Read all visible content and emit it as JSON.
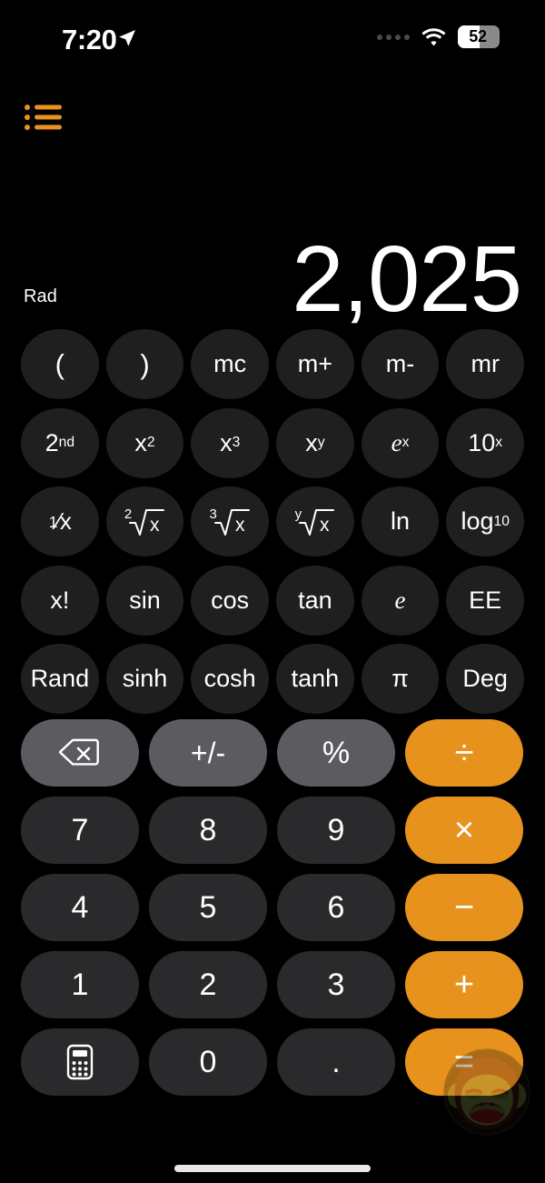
{
  "status_bar": {
    "time": "7:20",
    "location_icon": "location-arrow-icon",
    "signal_icon": "cellular-dots-icon",
    "wifi_icon": "wifi-icon",
    "battery_level": "52",
    "battery_percent": 52
  },
  "header": {
    "menu_icon": "list-bullet-icon",
    "menu_label": "History"
  },
  "display": {
    "mode": "Rad",
    "value": "2,025"
  },
  "scientific_keys": [
    [
      {
        "label": "(",
        "name": "open-paren-key"
      },
      {
        "label": ")",
        "name": "close-paren-key"
      },
      {
        "label": "mc",
        "name": "memory-clear-key"
      },
      {
        "label": "m+",
        "name": "memory-add-key"
      },
      {
        "label": "m-",
        "name": "memory-subtract-key"
      },
      {
        "label": "mr",
        "name": "memory-recall-key"
      }
    ],
    [
      {
        "label": "2nd",
        "name": "second-function-key"
      },
      {
        "label": "x2",
        "name": "x-squared-key"
      },
      {
        "label": "x3",
        "name": "x-cubed-key"
      },
      {
        "label": "xy",
        "name": "x-to-the-y-key"
      },
      {
        "label": "ex",
        "name": "e-to-the-x-key"
      },
      {
        "label": "10x",
        "name": "ten-to-the-x-key"
      }
    ],
    [
      {
        "label": "1/x",
        "name": "reciprocal-key"
      },
      {
        "label": "2root",
        "name": "square-root-key"
      },
      {
        "label": "3root",
        "name": "cube-root-key"
      },
      {
        "label": "yroot",
        "name": "y-root-key"
      },
      {
        "label": "ln",
        "name": "natural-log-key"
      },
      {
        "label": "log10",
        "name": "log-base-ten-key"
      }
    ],
    [
      {
        "label": "x!",
        "name": "factorial-key"
      },
      {
        "label": "sin",
        "name": "sine-key"
      },
      {
        "label": "cos",
        "name": "cosine-key"
      },
      {
        "label": "tan",
        "name": "tangent-key"
      },
      {
        "label": "e",
        "name": "euler-constant-key"
      },
      {
        "label": "EE",
        "name": "exponent-entry-key"
      }
    ],
    [
      {
        "label": "Rand",
        "name": "random-key"
      },
      {
        "label": "sinh",
        "name": "hyperbolic-sine-key"
      },
      {
        "label": "cosh",
        "name": "hyperbolic-cosine-key"
      },
      {
        "label": "tanh",
        "name": "hyperbolic-tangent-key"
      },
      {
        "label": "π",
        "name": "pi-key"
      },
      {
        "label": "Deg",
        "name": "degrees-toggle-key"
      }
    ]
  ],
  "keypad_rows": [
    [
      {
        "label": "",
        "name": "delete-key",
        "style": "func",
        "icon": "backspace-icon"
      },
      {
        "label": "+/-",
        "name": "plus-minus-key",
        "style": "func"
      },
      {
        "label": "%",
        "name": "percent-key",
        "style": "func"
      },
      {
        "label": "÷",
        "name": "divide-key",
        "style": "op"
      }
    ],
    [
      {
        "label": "7",
        "name": "digit-7-key",
        "style": "num"
      },
      {
        "label": "8",
        "name": "digit-8-key",
        "style": "num"
      },
      {
        "label": "9",
        "name": "digit-9-key",
        "style": "num"
      },
      {
        "label": "×",
        "name": "multiply-key",
        "style": "op"
      }
    ],
    [
      {
        "label": "4",
        "name": "digit-4-key",
        "style": "num"
      },
      {
        "label": "5",
        "name": "digit-5-key",
        "style": "num"
      },
      {
        "label": "6",
        "name": "digit-6-key",
        "style": "num"
      },
      {
        "label": "−",
        "name": "subtract-key",
        "style": "op"
      }
    ],
    [
      {
        "label": "1",
        "name": "digit-1-key",
        "style": "num"
      },
      {
        "label": "2",
        "name": "digit-2-key",
        "style": "num"
      },
      {
        "label": "3",
        "name": "digit-3-key",
        "style": "num"
      },
      {
        "label": "+",
        "name": "add-key",
        "style": "op"
      }
    ],
    [
      {
        "label": "",
        "name": "calculator-mode-key",
        "style": "num",
        "icon": "calculator-icon"
      },
      {
        "label": "0",
        "name": "digit-0-key",
        "style": "num"
      },
      {
        "label": ".",
        "name": "decimal-point-key",
        "style": "num"
      },
      {
        "label": "=",
        "name": "equals-key",
        "style": "op"
      }
    ]
  ],
  "watermark": {
    "icon": "monkey-face-icon"
  },
  "colors": {
    "background": "#000000",
    "accent_orange": "#e8921e",
    "menu_orange": "#e8921e",
    "key_dark": "#2a2a2c",
    "key_sci": "#1f1f1f",
    "key_function": "#5c5c60",
    "text_primary": "#ffffff"
  }
}
